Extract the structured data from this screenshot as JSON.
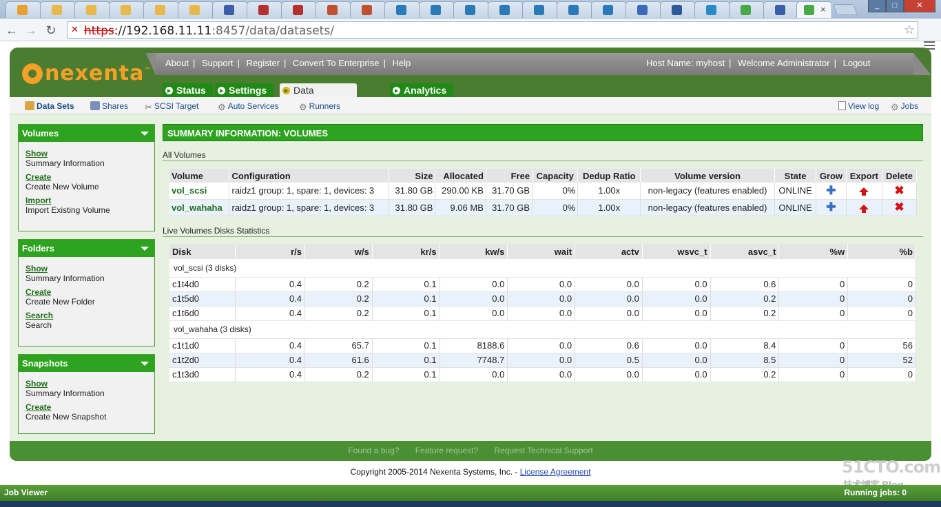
{
  "browser": {
    "url_protocol": "https",
    "url_rest": "://192.168.11.11",
    "url_port_path": ":8457/data/datasets/",
    "active_tab_close": "×",
    "tab_count": 23
  },
  "header": {
    "logo_text": "nexenta",
    "logo_tm": "™",
    "links": [
      "About",
      "Support",
      "Register",
      "Convert To Enterprise",
      "Help"
    ],
    "host_name": "Host Name: myhost",
    "welcome": "Welcome Administrator",
    "logout": "Logout",
    "separator": "|"
  },
  "main_tabs": [
    "Status",
    "Settings",
    "Data Management",
    "Analytics"
  ],
  "subnav": {
    "items": [
      "Data Sets",
      "Shares",
      "SCSI Target",
      "Auto Services",
      "Runners"
    ],
    "view_log": "View log",
    "jobs": "Jobs"
  },
  "sidebar": {
    "volumes": {
      "title": "Volumes",
      "links": [
        {
          "link": "Show",
          "desc": "Summary Information"
        },
        {
          "link": "Create",
          "desc": "Create New Volume"
        },
        {
          "link": "Import",
          "desc": "Import Existing Volume"
        }
      ]
    },
    "folders": {
      "title": "Folders",
      "links": [
        {
          "link": "Show",
          "desc": "Summary Information"
        },
        {
          "link": "Create",
          "desc": "Create New Folder"
        },
        {
          "link": "Search",
          "desc": "Search"
        }
      ]
    },
    "snapshots": {
      "title": "Snapshots",
      "links": [
        {
          "link": "Show",
          "desc": "Summary Information"
        },
        {
          "link": "Create",
          "desc": "Create New Snapshot"
        }
      ]
    }
  },
  "summary": {
    "title": "SUMMARY INFORMATION: VOLUMES",
    "all_volumes_label": "All Volumes",
    "live_label": "Live Volumes Disks Statistics"
  },
  "volumes_table": {
    "headers": [
      "Volume",
      "Configuration",
      "Size",
      "Allocated",
      "Free",
      "Capacity",
      "Dedup Ratio",
      "Volume version",
      "State",
      "Grow",
      "Export",
      "Delete"
    ],
    "rows": [
      [
        "vol_scsi",
        "raidz1 group: 1, spare: 1, devices: 3",
        "31.80 GB",
        "290.00 KB",
        "31.70 GB",
        "0%",
        "1.00x",
        "non-legacy (features enabled)",
        "ONLINE"
      ],
      [
        "vol_wahaha",
        "raidz1 group: 1, spare: 1, devices: 3",
        "31.80 GB",
        "9.06 MB",
        "31.70 GB",
        "0%",
        "1.00x",
        "non-legacy (features enabled)",
        "ONLINE"
      ]
    ]
  },
  "disks_table": {
    "headers": [
      "Disk",
      "r/s",
      "w/s",
      "kr/s",
      "kw/s",
      "wait",
      "actv",
      "wsvc_t",
      "asvc_t",
      "%w",
      "%b"
    ],
    "groups": [
      {
        "label": "vol_scsi (3 disks)",
        "rows": [
          [
            "c1t4d0",
            "0.4",
            "0.2",
            "0.1",
            "0.0",
            "0.0",
            "0.0",
            "0.0",
            "0.6",
            "0",
            "0"
          ],
          [
            "c1t5d0",
            "0.4",
            "0.2",
            "0.1",
            "0.0",
            "0.0",
            "0.0",
            "0.0",
            "0.2",
            "0",
            "0"
          ],
          [
            "c1t6d0",
            "0.4",
            "0.2",
            "0.1",
            "0.0",
            "0.0",
            "0.0",
            "0.0",
            "0.2",
            "0",
            "0"
          ]
        ]
      },
      {
        "label": "vol_wahaha (3 disks)",
        "rows": [
          [
            "c1t1d0",
            "0.4",
            "65.7",
            "0.1",
            "8188.6",
            "0.0",
            "0.6",
            "0.0",
            "8.4",
            "0",
            "56"
          ],
          [
            "c1t2d0",
            "0.4",
            "61.6",
            "0.1",
            "7748.7",
            "0.0",
            "0.5",
            "0.0",
            "8.5",
            "0",
            "52"
          ],
          [
            "c1t3d0",
            "0.4",
            "0.2",
            "0.1",
            "0.0",
            "0.0",
            "0.0",
            "0.0",
            "0.2",
            "0",
            "0"
          ]
        ]
      }
    ]
  },
  "footer": {
    "links": [
      "Found a bug?",
      "Feature request?",
      "Request Technical Support"
    ],
    "copyright": "Copyright 2005-2014 Nexenta Systems, Inc. - ",
    "license": "License Agreement"
  },
  "job_viewer": {
    "title": "Job Viewer",
    "right": "Running jobs: 0"
  },
  "watermark": {
    "main": "51CTO.com",
    "sub": "技术博客 Blog"
  },
  "colors": {
    "green": "#2da31f",
    "dark_green": "#4a7d30",
    "logo_orange": "#f7a028",
    "link_green": "#1f6e1a"
  }
}
